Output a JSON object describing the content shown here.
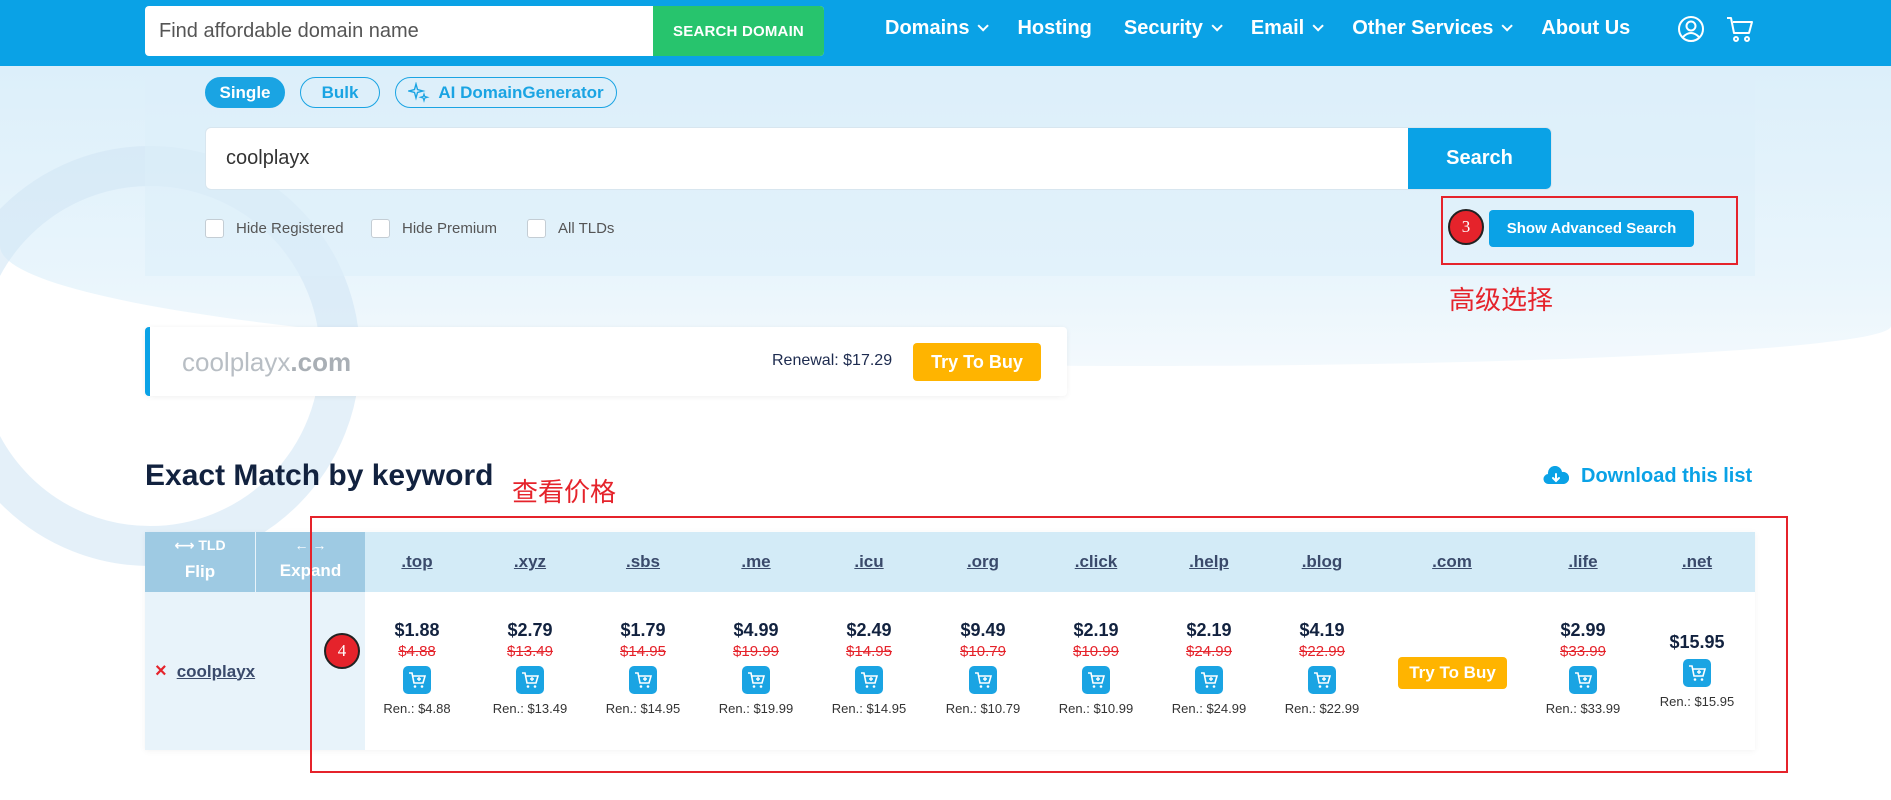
{
  "header": {
    "search_placeholder": "Find affordable domain name",
    "search_button": "SEARCH DOMAIN",
    "nav": [
      {
        "label": "Domains",
        "dropdown": true
      },
      {
        "label": "Hosting",
        "dropdown": false
      },
      {
        "label": "Security",
        "dropdown": true
      },
      {
        "label": "Email",
        "dropdown": true
      },
      {
        "label": "Other Services",
        "dropdown": true
      },
      {
        "label": "About Us",
        "dropdown": false
      }
    ],
    "icons": [
      "user-icon",
      "cart-icon"
    ],
    "bg_color": "#0aa2e6"
  },
  "search_panel": {
    "modes": [
      "Single",
      "Bulk",
      "AI DomainGenerator"
    ],
    "active_mode": "Single",
    "query": "coolplayx",
    "search_button": "Search",
    "filters": [
      "Hide Registered",
      "Hide Premium",
      "All TLDs"
    ],
    "advanced_button": "Show Advanced Search"
  },
  "annotations": {
    "circle_3": "3",
    "text_3": "高级选择",
    "circle_4": "4",
    "text_4": "查看价格",
    "color": "#e5232b"
  },
  "com_result": {
    "name": "coolplayx",
    "tld": ".com",
    "renewal": "Renewal: $17.29",
    "button": "Try To Buy"
  },
  "section": {
    "title": "Exact Match by keyword",
    "download": "Download this list"
  },
  "table": {
    "controls": [
      {
        "top": "⟷ TLD",
        "bottom": "Flip"
      },
      {
        "top": "← →",
        "bottom": "Expand"
      }
    ],
    "keyword": "coolplayx",
    "columns": [
      {
        "tld": ".top",
        "price": "$1.88",
        "old": "$4.88",
        "renew": "Ren.: $4.88"
      },
      {
        "tld": ".xyz",
        "price": "$2.79",
        "old": "$13.49",
        "renew": "Ren.: $13.49"
      },
      {
        "tld": ".sbs",
        "price": "$1.79",
        "old": "$14.95",
        "renew": "Ren.: $14.95"
      },
      {
        "tld": ".me",
        "price": "$4.99",
        "old": "$19.99",
        "renew": "Ren.: $19.99"
      },
      {
        "tld": ".icu",
        "price": "$2.49",
        "old": "$14.95",
        "renew": "Ren.: $14.95"
      },
      {
        "tld": ".org",
        "price": "$9.49",
        "old": "$10.79",
        "renew": "Ren.: $10.79"
      },
      {
        "tld": ".click",
        "price": "$2.19",
        "old": "$10.99",
        "renew": "Ren.: $10.99"
      },
      {
        "tld": ".help",
        "price": "$2.19",
        "old": "$24.99",
        "renew": "Ren.: $24.99"
      },
      {
        "tld": ".blog",
        "price": "$4.19",
        "old": "$22.99",
        "renew": "Ren.: $22.99"
      },
      {
        "tld": ".com",
        "button": "Try To Buy"
      },
      {
        "tld": ".life",
        "price": "$2.99",
        "old": "$33.99",
        "renew": "Ren.: $33.99"
      },
      {
        "tld": ".net",
        "price": "$15.95",
        "renew": "Ren.: $15.95"
      }
    ]
  }
}
